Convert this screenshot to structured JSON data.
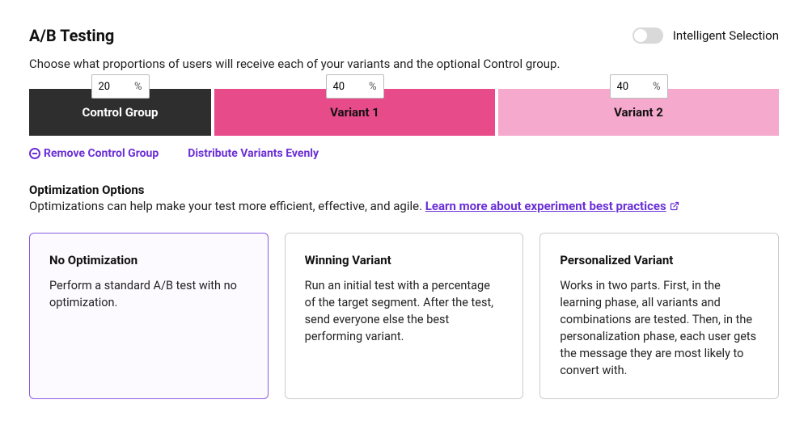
{
  "header": {
    "title": "A/B Testing",
    "toggle_label": "Intelligent Selection"
  },
  "subtitle": "Choose what proportions of users will receive each of your variants and the optional Control group.",
  "variants": {
    "pct_sign": "%",
    "control": {
      "label": "Control Group",
      "value": "20"
    },
    "v1": {
      "label": "Variant 1",
      "value": "40"
    },
    "v2": {
      "label": "Variant 2",
      "value": "40"
    }
  },
  "actions": {
    "remove_control": "Remove Control Group",
    "distribute_evenly": "Distribute Variants Evenly"
  },
  "optimization": {
    "title": "Optimization Options",
    "subtitle_prefix": "Optimizations can help make your test more efficient, effective, and agile. ",
    "learn_more": "Learn more about experiment best practices"
  },
  "cards": {
    "no_opt": {
      "title": "No Optimization",
      "body": "Perform a standard A/B test with no optimization."
    },
    "winning": {
      "title": "Winning Variant",
      "body": "Run an initial test with a percentage of the target segment. After the test, send everyone else the best performing variant."
    },
    "personalized": {
      "title": "Personalized Variant",
      "body": "Works in two parts. First, in the learning phase, all variants and combinations are tested. Then, in the personalization phase, each user gets the message they are most likely to convert with."
    }
  }
}
